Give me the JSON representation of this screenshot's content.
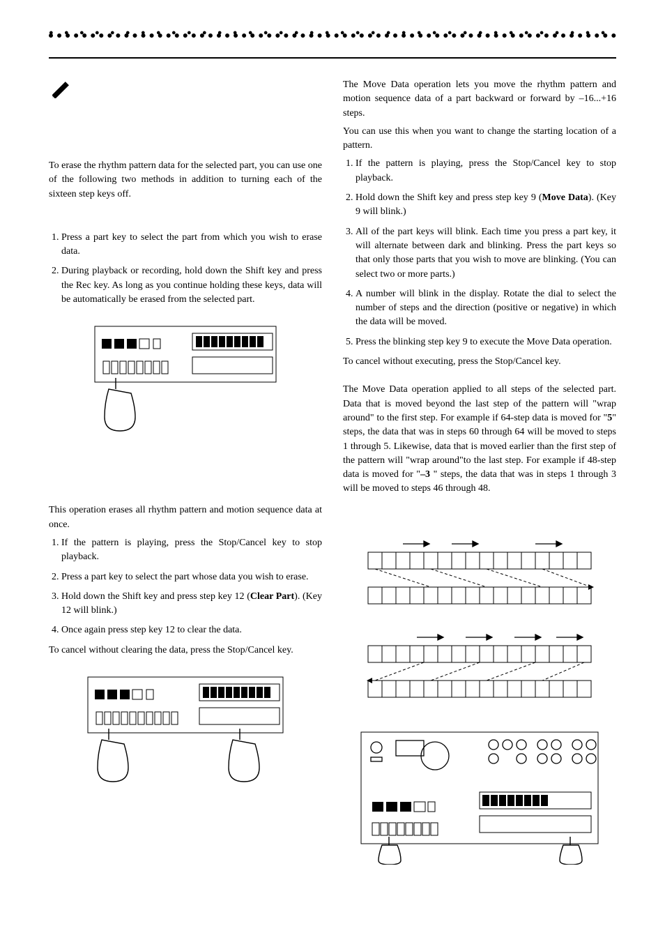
{
  "left": {
    "intro": "To erase the rhythm pattern data for the selected part, you can use one of the following two methods in addition to turning each of the sixteen step keys off.",
    "method1": {
      "step1": "Press a part key to select the part from which you wish to erase data.",
      "step2": "During playback or recording, hold down the Shift key and press the Rec key. As long as you continue holding these keys, data will be automatically be erased from the selected part."
    },
    "method2_intro": "This operation erases all rhythm pattern and motion sequence data at once.",
    "method2": {
      "step1": "If the pattern is playing, press the Stop/Cancel key to stop playback.",
      "step2": "Press a part key to select the part whose data you wish to erase.",
      "step3_pre": "Hold down the Shift key and press step key 12 (",
      "step3_bold": "Clear Part",
      "step3_post": "). (Key 12 will blink.)",
      "step4": "Once again press step key 12 to clear the data."
    },
    "method2_cancel": "To cancel without clearing the data, press the Stop/Cancel key."
  },
  "right": {
    "p1": "The Move Data operation lets you move the rhythm pattern and motion sequence data of a part backward or forward by –16...+16 steps.",
    "p2": "You can use this when you want to change the starting location of a pattern.",
    "steps": {
      "s1": "If the pattern is playing, press the Stop/Cancel key to stop playback.",
      "s2_pre": "Hold down the Shift key and press step key 9 (",
      "s2_bold": "Move Data",
      "s2_post": "). (Key 9 will blink.)",
      "s3": "All of the part keys will blink. Each time you press a part key, it will alternate between dark and blinking. Press the part keys so that only those parts that you wish to move are blinking. (You can select two or more parts.)",
      "s4": "A number will blink in the display. Rotate the dial to select the number of steps and the direction (positive or negative) in which the data will be moved.",
      "s5": "Press the blinking step key 9 to execute the Move Data operation."
    },
    "cancel": "To cancel without executing, press the Stop/Cancel key.",
    "explain_pre": "The Move Data operation applied to all steps of the selected part. Data that is moved beyond the last step of the pattern will \"wrap around\" to the first step. For example if 64-step data is moved for \"",
    "explain_b1": "5",
    "explain_mid": "\" steps, the data that was in steps 60 through 64 will be moved to steps 1 through 5. Likewise, data that is moved earlier than the first step of the pattern will \"wrap around\"to the last step. For example if 48-step data is moved for \"",
    "explain_b2": "–3",
    "explain_post": " \" steps, the data that was in steps 1 through 3 will be moved to steps 46 through 48."
  }
}
